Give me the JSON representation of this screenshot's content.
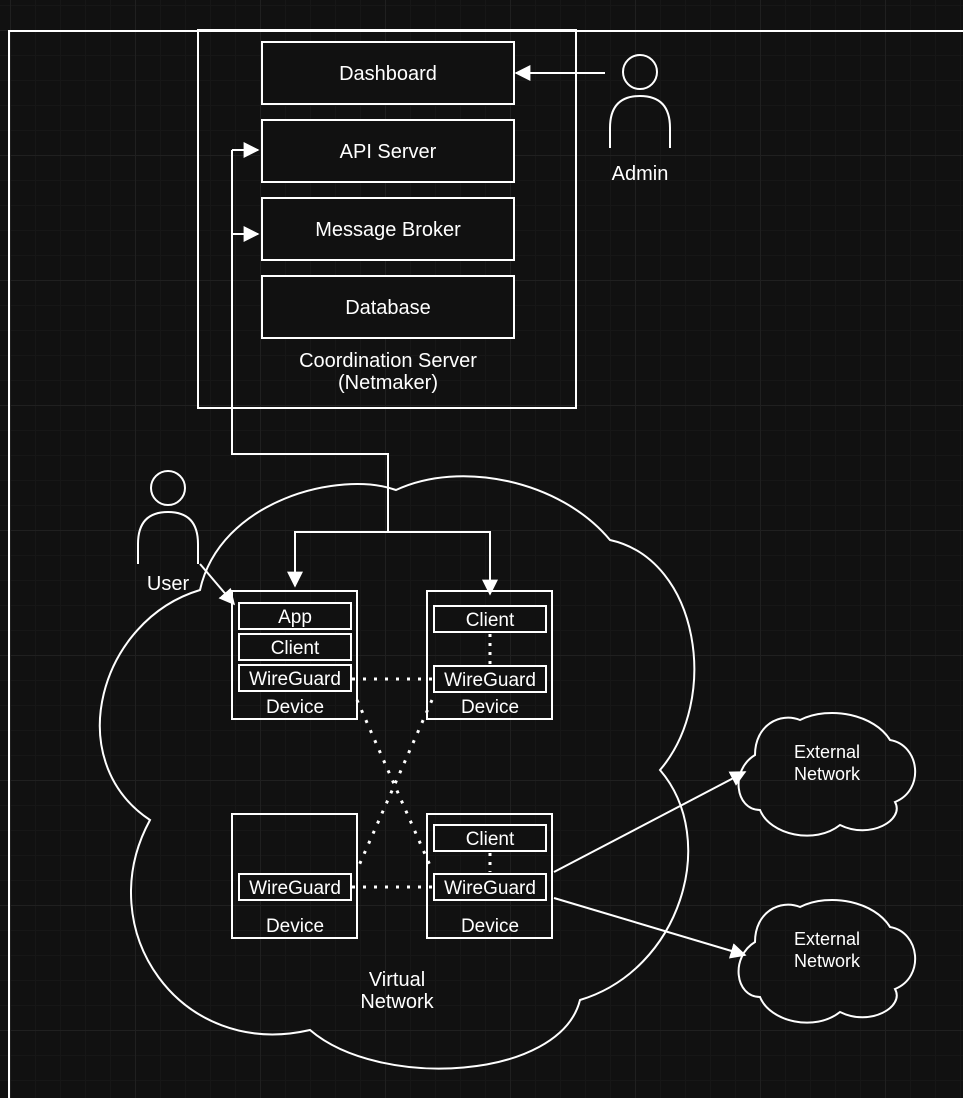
{
  "coordination": {
    "title1": "Coordination Server",
    "title2": "(Netmaker)",
    "dashboard": "Dashboard",
    "api": "API Server",
    "broker": "Message Broker",
    "database": "Database"
  },
  "actors": {
    "admin": "Admin",
    "user": "User"
  },
  "virtual_network": {
    "title1": "Virtual",
    "title2": "Network"
  },
  "devices": {
    "d1": {
      "app": "App",
      "client": "Client",
      "wg": "WireGuard",
      "label": "Device"
    },
    "d2": {
      "client": "Client",
      "wg": "WireGuard",
      "label": "Device"
    },
    "d3": {
      "wg": "WireGuard",
      "label": "Device"
    },
    "d4": {
      "client": "Client",
      "wg": "WireGuard",
      "label": "Device"
    }
  },
  "external": {
    "e1a": "External",
    "e1b": "Network",
    "e2a": "External",
    "e2b": "Network"
  }
}
